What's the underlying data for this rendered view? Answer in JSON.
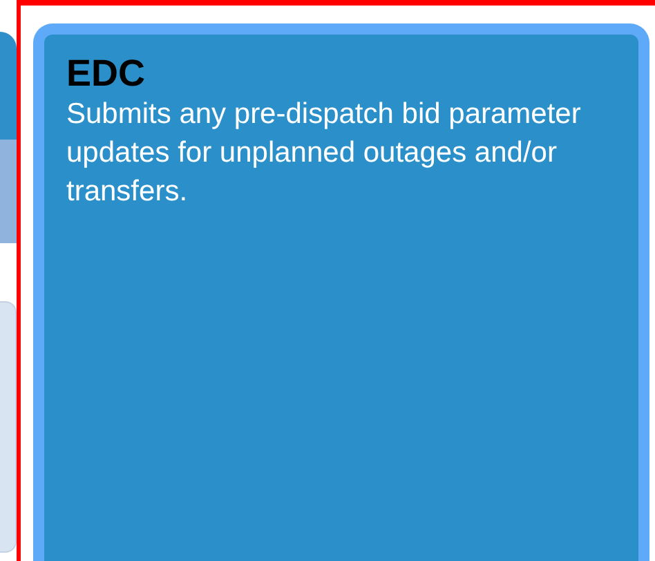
{
  "card": {
    "title": "EDC",
    "description": "Submits any pre-dispatch bid parameter updates for unplanned outages and/or transfers."
  }
}
